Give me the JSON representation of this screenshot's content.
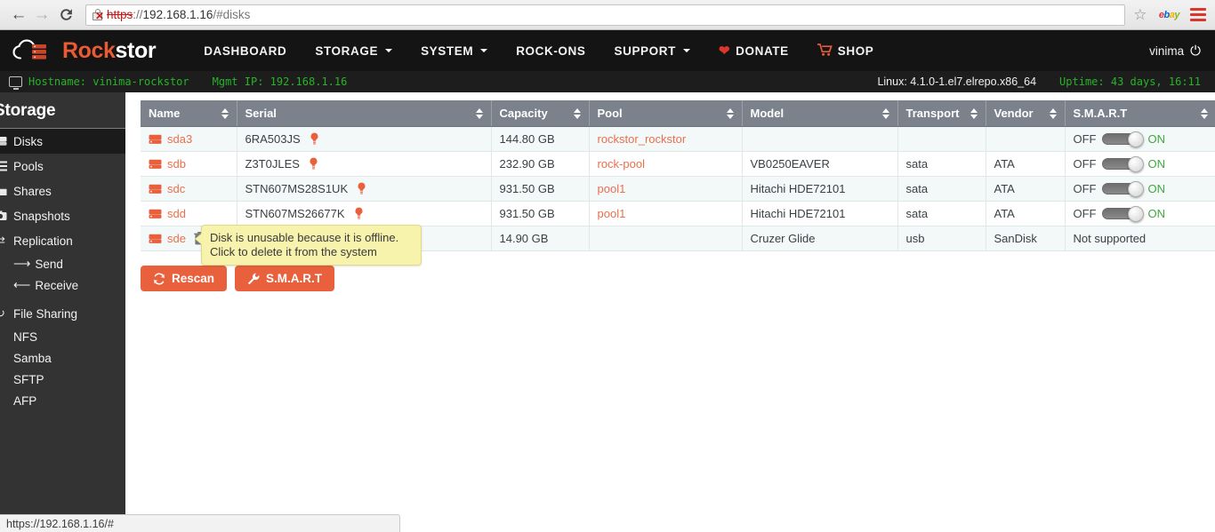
{
  "browser": {
    "back_icon": "back-arrow-icon",
    "forward_icon": "forward-arrow-icon",
    "reload_icon": "reload-icon",
    "url_scheme": "https",
    "url_separator": "://",
    "url_host": "192.168.1.16",
    "url_path": "/#disks",
    "security_icon": "broken-lock-icon",
    "bookmark_icon": "star-icon",
    "extension_label": "ebay",
    "menu_icon": "hamburger-menu-icon",
    "status_link": "https://192.168.1.16/#"
  },
  "navbar": {
    "brand_part1": "Rock",
    "brand_part2": "stor",
    "links": [
      {
        "label": "DASHBOARD",
        "caret": false,
        "icon": null
      },
      {
        "label": "STORAGE",
        "caret": true,
        "icon": null
      },
      {
        "label": "SYSTEM",
        "caret": true,
        "icon": null
      },
      {
        "label": "ROCK-ONS",
        "caret": false,
        "icon": null
      },
      {
        "label": "SUPPORT",
        "caret": true,
        "icon": null
      },
      {
        "label": "DONATE",
        "caret": false,
        "icon": "heart-icon"
      },
      {
        "label": "SHOP",
        "caret": false,
        "icon": "cart-icon"
      }
    ],
    "user": "vinima",
    "logout_icon": "power-icon"
  },
  "statusbar": {
    "monitor_icon": "monitor-icon",
    "hostname": "Hostname: vinima-rockstor",
    "mgmt_ip": "Mgmt IP: 192.168.1.16",
    "kernel": "Linux: 4.1.0-1.el7.elrepo.x86_64",
    "uptime": "Uptime: 43 days, 16:11"
  },
  "sidebar": {
    "title": "Storage",
    "items": [
      {
        "label": "Disks",
        "icon": "hdd-icon",
        "active": true
      },
      {
        "label": "Pools",
        "icon": "pools-icon",
        "active": false
      },
      {
        "label": "Shares",
        "icon": "folder-icon",
        "active": false
      },
      {
        "label": "Snapshots",
        "icon": "camera-icon",
        "active": false
      },
      {
        "label": "Replication",
        "icon": "exchange-icon",
        "active": false
      }
    ],
    "replication_subitems": [
      {
        "label": "Send",
        "icon": "arrow-right-icon"
      },
      {
        "label": "Receive",
        "icon": "arrow-left-icon"
      }
    ],
    "file_sharing": {
      "label": "File Sharing",
      "icon": "share-icon"
    },
    "file_sharing_subitems": [
      {
        "label": "NFS"
      },
      {
        "label": "Samba"
      },
      {
        "label": "SFTP"
      },
      {
        "label": "AFP"
      }
    ]
  },
  "table": {
    "columns": [
      {
        "label": "Name",
        "sortable": true
      },
      {
        "label": "Serial",
        "sortable": true
      },
      {
        "label": "Capacity",
        "sortable": true
      },
      {
        "label": "Pool",
        "sortable": true
      },
      {
        "label": "Model",
        "sortable": true
      },
      {
        "label": "Transport",
        "sortable": true
      },
      {
        "label": "Vendor",
        "sortable": true
      },
      {
        "label": "S.M.A.R.T",
        "sortable": true
      }
    ],
    "rows": [
      {
        "name": "sda3",
        "serial": "6RA503JS",
        "serial_hint_icon": "lightbulb-icon",
        "capacity": "144.80 GB",
        "pool": "rockstor_rockstor",
        "model": "",
        "transport": "",
        "vendor": "",
        "smart": {
          "type": "toggle",
          "off_label": "OFF",
          "on_label": "ON",
          "state": "on"
        },
        "delete_icon": false
      },
      {
        "name": "sdb",
        "serial": "Z3T0JLES",
        "serial_hint_icon": "lightbulb-icon",
        "capacity": "232.90 GB",
        "pool": "rock-pool",
        "model": "VB0250EAVER",
        "transport": "sata",
        "vendor": "ATA",
        "smart": {
          "type": "toggle",
          "off_label": "OFF",
          "on_label": "ON",
          "state": "on"
        },
        "delete_icon": false
      },
      {
        "name": "sdc",
        "serial": "STN607MS28S1UK",
        "serial_hint_icon": "lightbulb-icon",
        "capacity": "931.50 GB",
        "pool": "pool1",
        "model": "Hitachi HDE72101",
        "transport": "sata",
        "vendor": "ATA",
        "smart": {
          "type": "toggle",
          "off_label": "OFF",
          "on_label": "ON",
          "state": "on"
        },
        "delete_icon": false
      },
      {
        "name": "sdd",
        "serial": "STN607MS26677K",
        "serial_hint_icon": "lightbulb-icon",
        "capacity": "931.50 GB",
        "pool": "pool1",
        "model": "Hitachi HDE72101",
        "transport": "sata",
        "vendor": "ATA",
        "smart": {
          "type": "toggle",
          "off_label": "OFF",
          "on_label": "ON",
          "state": "on"
        },
        "delete_icon": false
      },
      {
        "name": "sde",
        "serial": "",
        "serial_hint_icon": null,
        "capacity": "14.90 GB",
        "pool": "",
        "model": "Cruzer Glide",
        "transport": "usb",
        "vendor": "SanDisk",
        "smart": {
          "type": "text",
          "text": "Not supported"
        },
        "delete_icon": true
      }
    ]
  },
  "tooltip": {
    "text": "Disk is unusable because it is offline. Click to delete it from the system"
  },
  "buttons": {
    "rescan": {
      "label": "Rescan",
      "icon": "refresh-icon"
    },
    "smart": {
      "label": "S.M.A.R.T",
      "icon": "wrench-icon"
    }
  },
  "colors": {
    "accent_orange": "#e8613c",
    "link_orange": "#ec6e4c",
    "navbar_black": "#141414",
    "sidebar_gray": "#333333",
    "table_header_gray": "#7b828c",
    "status_green": "#27b327",
    "toggle_on_green": "#3fa83f",
    "tooltip_yellow": "#f7f3ad"
  }
}
